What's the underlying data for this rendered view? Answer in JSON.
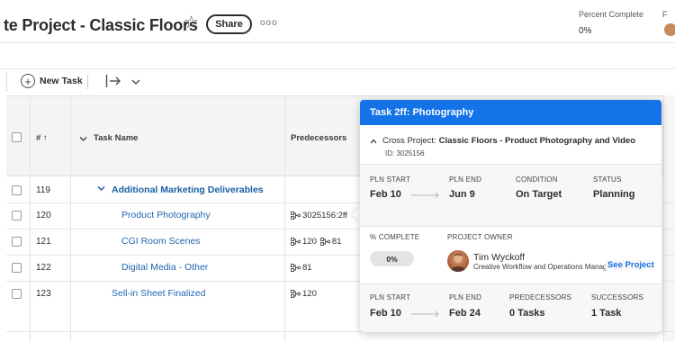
{
  "header": {
    "title": "te Project - Classic Floors",
    "share_label": "Share",
    "more_label": "ooo",
    "percent_complete_label": "Percent Complete",
    "percent_complete_value": "0%",
    "edge_letter": "F"
  },
  "toolbar": {
    "new_task_label": "New Task"
  },
  "grid": {
    "columns": {
      "number": "# ↑",
      "task_name": "Task Name",
      "predecessors": "Predecessors"
    },
    "rows": [
      {
        "num": "119",
        "name": "Additional Marketing Deliverables",
        "predecessors": [],
        "bold": true,
        "expandable": true
      },
      {
        "num": "120",
        "name": "Product Photography",
        "predecessors": [
          "3025156:2ff"
        ]
      },
      {
        "num": "121",
        "name": "CGI Room Scenes",
        "predecessors": [
          "120",
          "81"
        ]
      },
      {
        "num": "122",
        "name": "Digital Media - Other",
        "predecessors": [
          "81"
        ]
      },
      {
        "num": "123",
        "name": "Sell-in Sheet Finalized",
        "predecessors": [
          "120"
        ]
      }
    ]
  },
  "popover": {
    "title": "Task 2ff: Photography",
    "cross_project_label": "Cross Project:",
    "cross_project_name": "Classic Floors - Product Photography and Video",
    "id_text": "ID: 3025156",
    "band1": {
      "pln_start_label": "PLN START",
      "pln_start": "Feb 10",
      "pln_end_label": "PLN END",
      "pln_end": "Jun 9",
      "condition_label": "CONDITION",
      "condition": "On Target",
      "status_label": "STATUS",
      "status": "Planning"
    },
    "middle": {
      "pct_label": "% COMPLETE",
      "pct_value": "0%",
      "owner_label": "PROJECT OWNER",
      "owner_name": "Tim Wyckoff",
      "owner_role": "Creative Workflow and Operations Manager",
      "see_project": "See Project"
    },
    "band2": {
      "pln_start_label": "PLN START",
      "pln_start": "Feb 10",
      "pln_end_label": "PLN END",
      "pln_end": "Feb 24",
      "pred_label": "PREDECESSORS",
      "pred_value": "0 Tasks",
      "succ_label": "SUCCESSORS",
      "succ_value": "1 Task"
    }
  },
  "colors": {
    "accent": "#1473e6",
    "link": "#2068b0"
  }
}
